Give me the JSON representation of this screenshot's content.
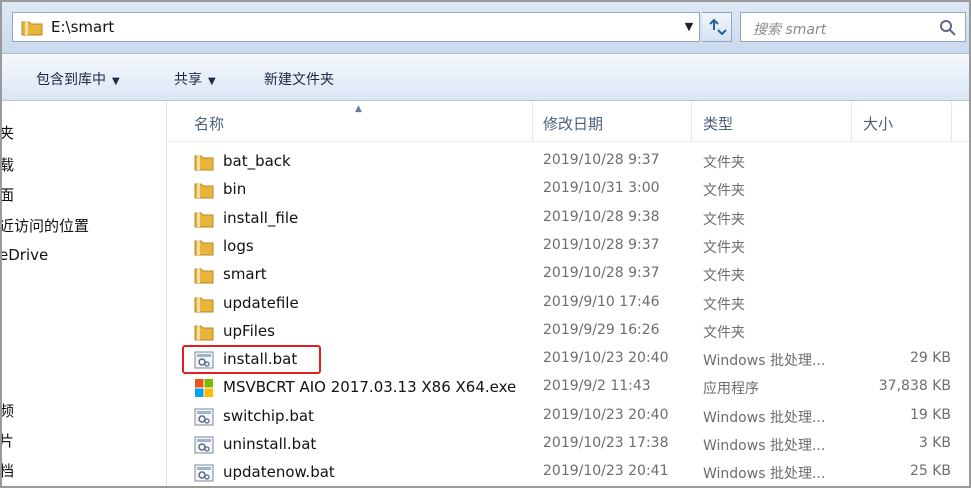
{
  "address_bar": {
    "path": "E:\\smart"
  },
  "search": {
    "placeholder": "搜索 smart"
  },
  "toolbar": {
    "include_in_library": "包含到库中",
    "share": "共享",
    "new_folder": "新建文件夹"
  },
  "nav_pane": {
    "items": [
      "夹",
      "载",
      "面",
      "近访问的位置",
      "eDrive",
      "频",
      "片",
      "档"
    ]
  },
  "columns": {
    "name": "名称",
    "date": "修改日期",
    "type": "类型",
    "size": "大小"
  },
  "files": [
    {
      "name": "bat_back",
      "date": "2019/10/28 9:37",
      "type": "文件夹",
      "size": "",
      "icon": "folder-icon"
    },
    {
      "name": "bin",
      "date": "2019/10/31 3:00",
      "type": "文件夹",
      "size": "",
      "icon": "folder-icon"
    },
    {
      "name": "install_file",
      "date": "2019/10/28 9:38",
      "type": "文件夹",
      "size": "",
      "icon": "folder-icon"
    },
    {
      "name": "logs",
      "date": "2019/10/28 9:37",
      "type": "文件夹",
      "size": "",
      "icon": "folder-icon"
    },
    {
      "name": "smart",
      "date": "2019/10/28 9:37",
      "type": "文件夹",
      "size": "",
      "icon": "folder-icon"
    },
    {
      "name": "updatefile",
      "date": "2019/9/10 17:46",
      "type": "文件夹",
      "size": "",
      "icon": "folder-icon"
    },
    {
      "name": "upFiles",
      "date": "2019/9/29 16:26",
      "type": "文件夹",
      "size": "",
      "icon": "folder-icon"
    },
    {
      "name": "install.bat",
      "date": "2019/10/23 20:40",
      "type": "Windows 批处理...",
      "size": "29 KB",
      "icon": "batch-file-icon"
    },
    {
      "name": "MSVBCRT AIO 2017.03.13 X86 X64.exe",
      "date": "2019/9/2 11:43",
      "type": "应用程序",
      "size": "37,838 KB",
      "icon": "installer-icon"
    },
    {
      "name": "switchip.bat",
      "date": "2019/10/23 20:40",
      "type": "Windows 批处理...",
      "size": "19 KB",
      "icon": "batch-file-icon"
    },
    {
      "name": "uninstall.bat",
      "date": "2019/10/23 17:38",
      "type": "Windows 批处理...",
      "size": "3 KB",
      "icon": "batch-file-icon"
    },
    {
      "name": "updatenow.bat",
      "date": "2019/10/23 20:41",
      "type": "Windows 批处理...",
      "size": "25 KB",
      "icon": "batch-file-icon"
    }
  ],
  "colors": {
    "highlight_border": "#e02020",
    "folder": "#e8b43a",
    "toolbar_bg": "#dbe6f4"
  }
}
